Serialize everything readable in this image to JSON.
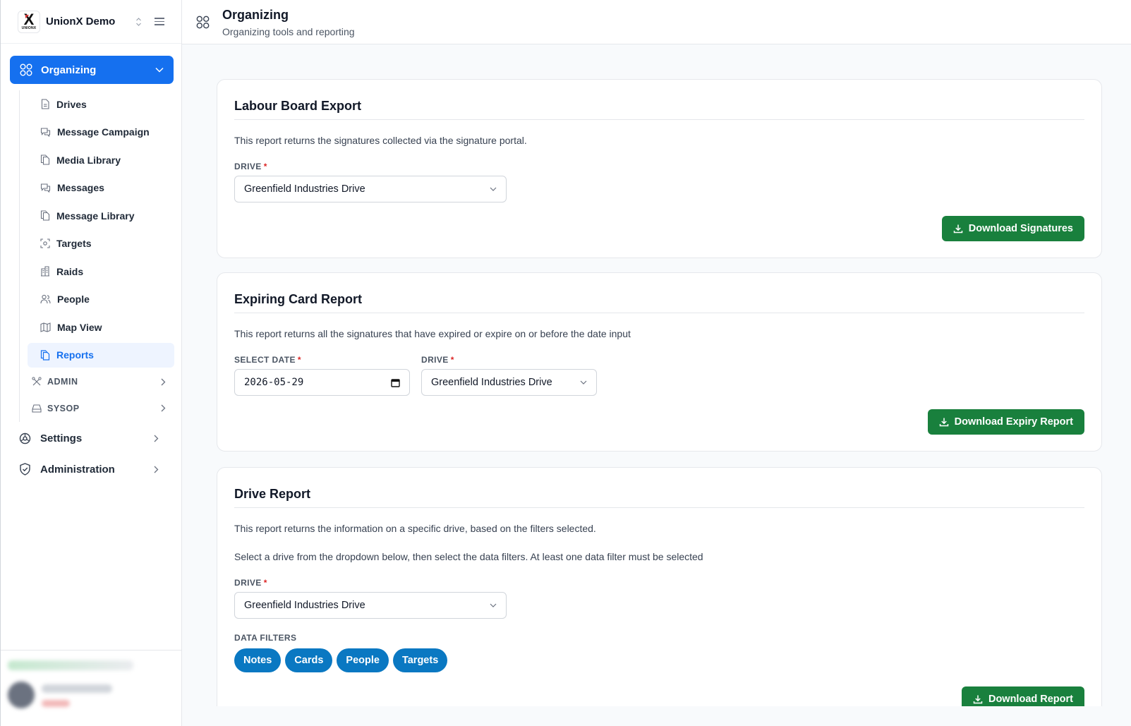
{
  "brand": {
    "name": "UnionX Demo",
    "logo_text": "UNIONX"
  },
  "sidebar": {
    "active_section": "Organizing",
    "items": [
      {
        "label": "Drives",
        "icon": "file-icon"
      },
      {
        "label": "Message Campaign",
        "icon": "chat-icon"
      },
      {
        "label": "Media Library",
        "icon": "copy-icon"
      },
      {
        "label": "Messages",
        "icon": "chat-icon"
      },
      {
        "label": "Message Library",
        "icon": "copy-icon"
      },
      {
        "label": "Targets",
        "icon": "target-icon"
      },
      {
        "label": "Raids",
        "icon": "building-icon"
      },
      {
        "label": "People",
        "icon": "people-icon"
      },
      {
        "label": "Map View",
        "icon": "map-icon"
      },
      {
        "label": "Reports",
        "icon": "copy-icon",
        "active": true
      }
    ],
    "groups": [
      {
        "label": "ADMIN"
      },
      {
        "label": "SYSOP"
      }
    ],
    "top_items": [
      {
        "label": "Settings"
      },
      {
        "label": "Administration"
      }
    ]
  },
  "header": {
    "title": "Organizing",
    "subtitle": "Organizing tools and reporting"
  },
  "labour": {
    "title": "Labour Board Export",
    "desc": "This report returns the signatures collected via the signature portal.",
    "drive_label": "DRIVE",
    "drive_value": "Greenfield Industries Drive",
    "button": "Download Signatures"
  },
  "expiring": {
    "title": "Expiring Card Report",
    "desc": "This report returns all the signatures that have expired or expire on or before the date input",
    "date_label": "SELECT DATE",
    "date_value": "2026-05-29",
    "drive_label": "DRIVE",
    "drive_value": "Greenfield Industries Drive",
    "button": "Download Expiry Report"
  },
  "drive_report": {
    "title": "Drive Report",
    "desc1": "This report returns the information on a specific drive, based on the filters selected.",
    "desc2": "Select a drive from the dropdown below, then select the data filters. At least one data filter must be selected",
    "drive_label": "DRIVE",
    "drive_value": "Greenfield Industries Drive",
    "filters_label": "DATA FILTERS",
    "filters": [
      "Notes",
      "Cards",
      "People",
      "Targets"
    ],
    "button": "Download Report"
  },
  "colors": {
    "primary": "#1570ef",
    "success": "#19803d",
    "chip": "#0a78c2",
    "required": "#dc2626"
  }
}
